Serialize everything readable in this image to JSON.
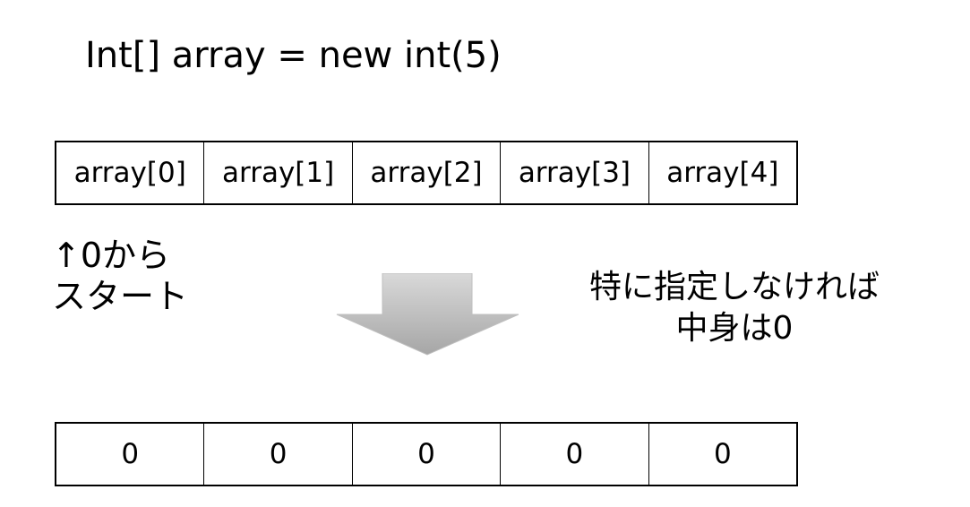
{
  "title": "Int[] array = new int(5)",
  "index_cells": [
    "array[0]",
    "array[1]",
    "array[2]",
    "array[3]",
    "array[4]"
  ],
  "value_cells": [
    "0",
    "0",
    "0",
    "0",
    "0"
  ],
  "start_note": {
    "line1": "↑0から",
    "line2": "スタート"
  },
  "default_note": {
    "line1": "特に指定しなければ",
    "line2": "中身は0"
  },
  "colors": {
    "arrow_top": "#d9d9d9",
    "arrow_bottom": "#a6a6a6",
    "border": "#000000"
  },
  "icons": {
    "arrow": "down-arrow-icon"
  }
}
